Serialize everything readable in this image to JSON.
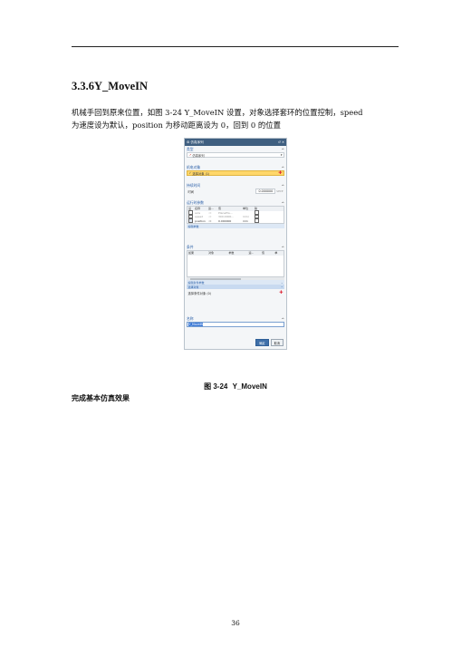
{
  "section_title": "3.3.6Y_MoveIN",
  "paragraph_lines": [
    "机械手回到原来位置，如图 3-24 Y_MoveIN 设置，对象选择套环的位置控制，speed",
    "为速度设为默认，position 为移动距离设为 0，回到 0 的位置"
  ],
  "dialog": {
    "title": "仿真序列",
    "section_type": "类型",
    "type_value": "仿真序列",
    "section_object": "机电对象",
    "object_value": "选择对象 (1)",
    "section_duration": "持续时间",
    "time_label": "时间",
    "time_value": "0.000000",
    "time_unit": "sec",
    "section_params": "运行时参数",
    "param_headers": [
      "设",
      "名称",
      "运...",
      "值",
      "单位",
      "输"
    ],
    "params": [
      {
        "checked": false,
        "name": "axis",
        "op": ":=",
        "value": "PlanePla...",
        "unit": ""
      },
      {
        "checked": false,
        "name": "speed",
        "op": ":=",
        "value": "300.0000...",
        "unit": "mm/"
      },
      {
        "checked": true,
        "name": "position",
        "op": ":=",
        "value": "0.000000",
        "unit": "mm"
      }
    ],
    "edit_params": "编辑参数",
    "section_condition": "条件",
    "cond_headers": [
      "如果",
      "对象",
      "参数",
      "运...",
      "值",
      "单"
    ],
    "edit_cond_params": "编辑条件参数",
    "select_object_bar": "选择对象",
    "select_cond_object": "选择条件对象 (0)",
    "section_name": "名称",
    "name_value": "Y_MoveIN",
    "ok_label": "确定",
    "cancel_label": "取消"
  },
  "figure_caption_num": "图 3-24",
  "figure_caption_text": "Y_MoveIN",
  "closing_line": "完成基本仿真效果",
  "page_number": "36"
}
